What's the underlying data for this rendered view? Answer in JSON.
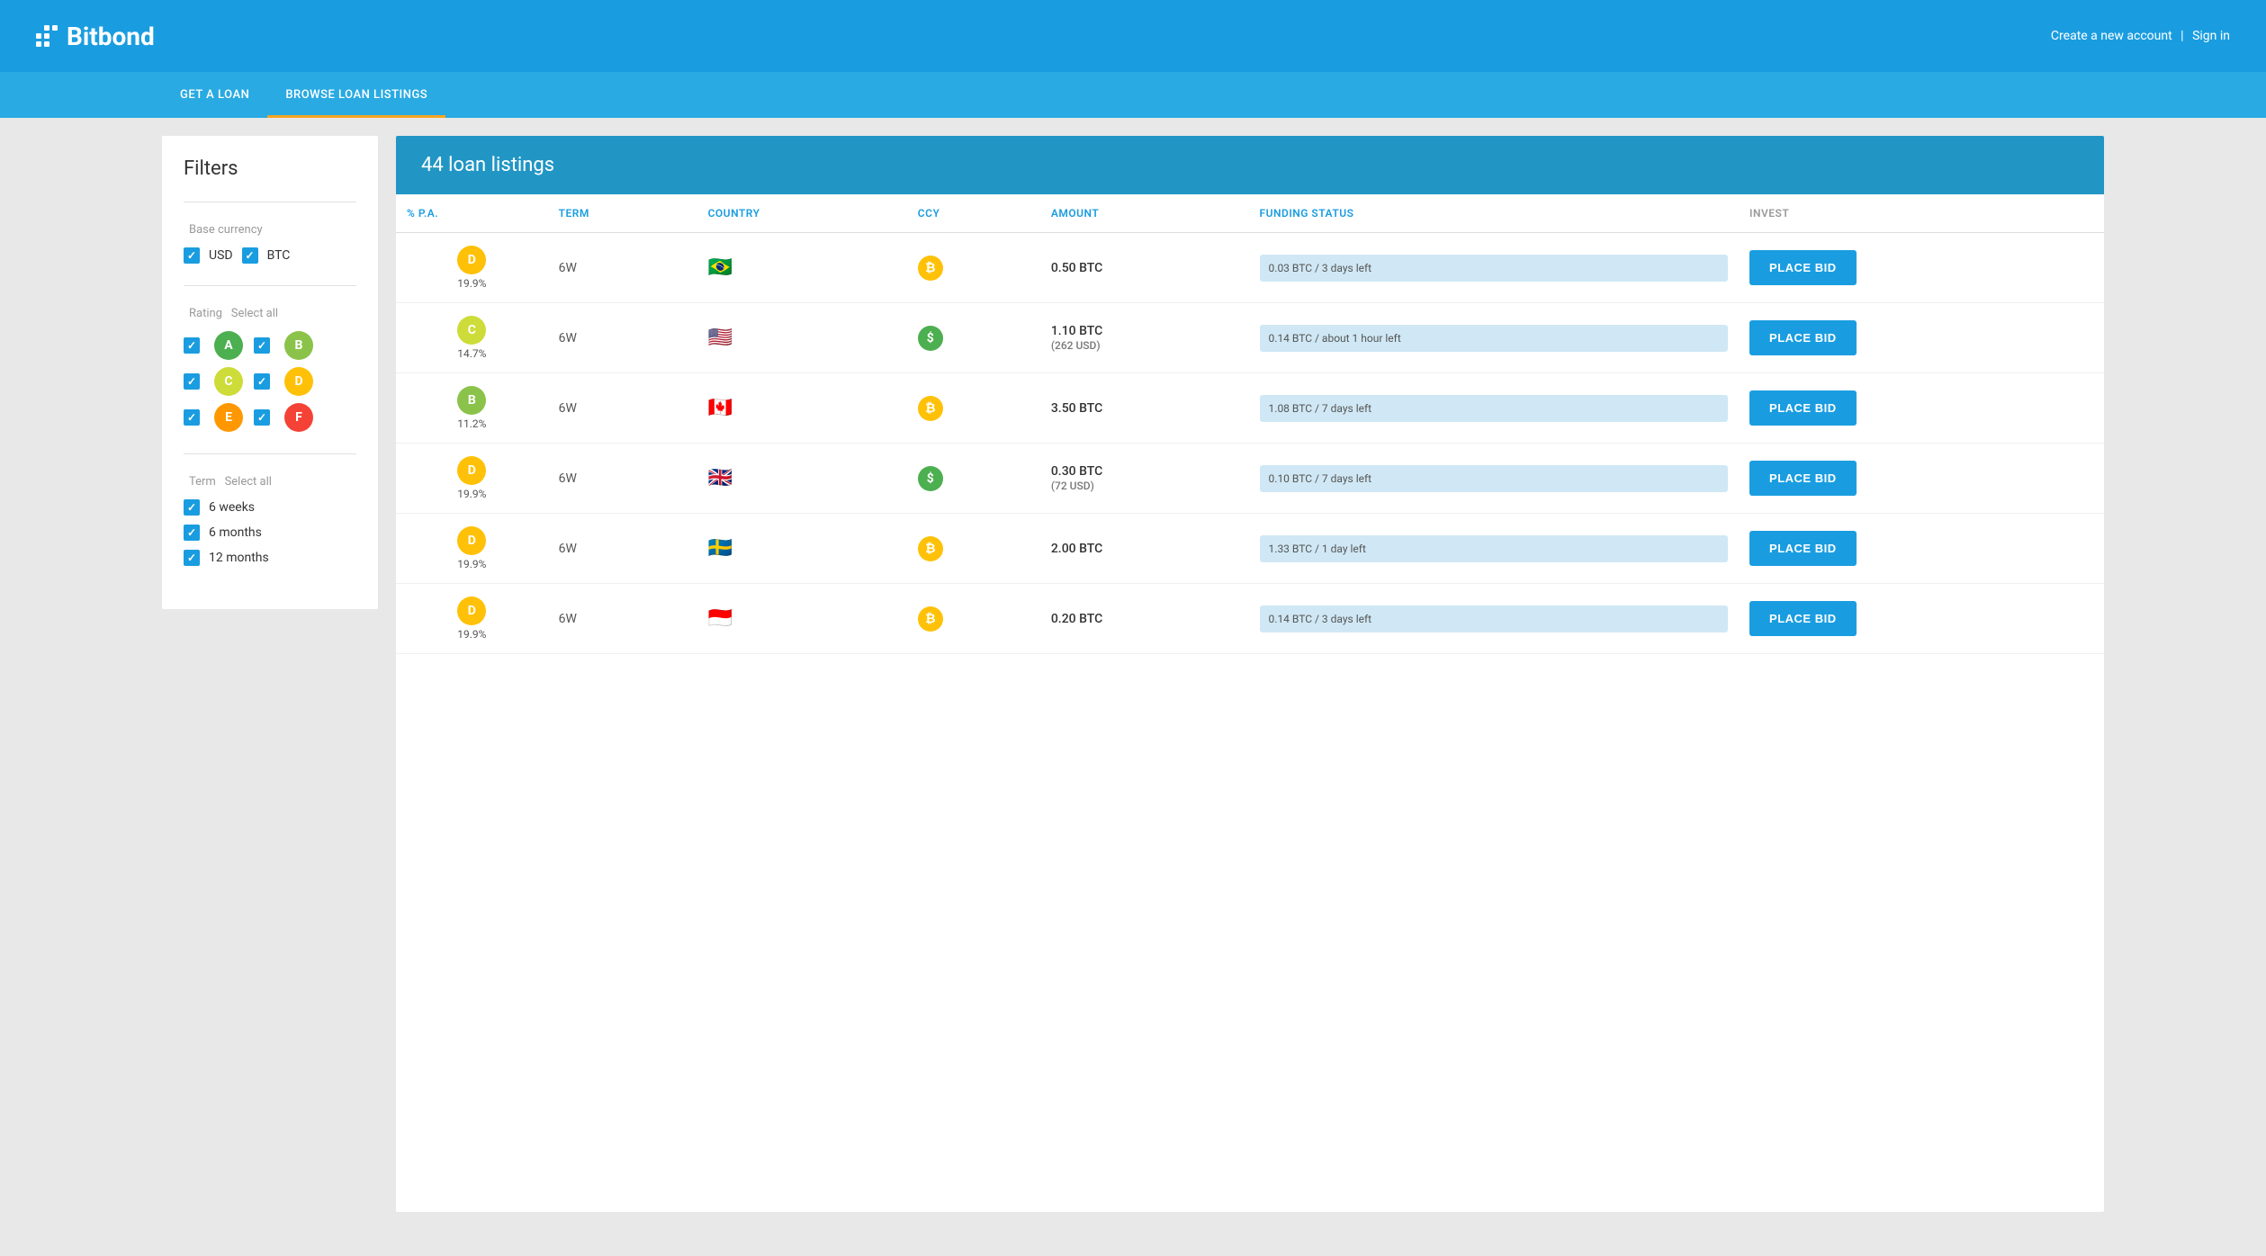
{
  "header": {
    "logo_text": "Bitbond",
    "create_account": "Create a new account",
    "separator": "|",
    "sign_in": "Sign in"
  },
  "nav": {
    "items": [
      {
        "id": "get-a-loan",
        "label": "GET A LOAN",
        "active": false
      },
      {
        "id": "browse-loan-listings",
        "label": "BROWSE LOAN LISTINGS",
        "active": true
      }
    ]
  },
  "filters": {
    "title": "Filters",
    "sections": [
      {
        "id": "base-currency",
        "title": "Base currency",
        "select_all": null,
        "currencies": [
          {
            "id": "usd",
            "label": "USD",
            "checked": true
          },
          {
            "id": "btc",
            "label": "BTC",
            "checked": true
          }
        ]
      },
      {
        "id": "rating",
        "title": "Rating",
        "select_all": "Select all",
        "badges": [
          {
            "id": "a",
            "label": "A",
            "color": "#4caf50",
            "checked": true
          },
          {
            "id": "b",
            "label": "B",
            "color": "#8bc34a",
            "checked": true
          },
          {
            "id": "c",
            "label": "C",
            "color": "#cddc39",
            "checked": true
          },
          {
            "id": "d",
            "label": "D",
            "color": "#ffc107",
            "checked": true
          },
          {
            "id": "e",
            "label": "E",
            "color": "#ff9800",
            "checked": true
          },
          {
            "id": "f",
            "label": "F",
            "color": "#f44336",
            "checked": true
          }
        ]
      },
      {
        "id": "term",
        "title": "Term",
        "select_all": "Select all",
        "terms": [
          {
            "id": "6w",
            "label": "6 weeks",
            "checked": true
          },
          {
            "id": "6m",
            "label": "6 months",
            "checked": true
          },
          {
            "id": "12m",
            "label": "12 months",
            "checked": true
          }
        ]
      }
    ]
  },
  "listings": {
    "title": "44 loan listings",
    "columns": [
      {
        "id": "pct",
        "label": "% P.A.",
        "color": "blue"
      },
      {
        "id": "term",
        "label": "TERM",
        "color": "blue"
      },
      {
        "id": "country",
        "label": "COUNTRY",
        "color": "blue"
      },
      {
        "id": "ccy",
        "label": "CCY",
        "color": "blue"
      },
      {
        "id": "amount",
        "label": "AMOUNT",
        "color": "blue"
      },
      {
        "id": "funding_status",
        "label": "FUNDING STATUS",
        "color": "blue"
      },
      {
        "id": "invest",
        "label": "INVEST",
        "color": "gray"
      }
    ],
    "rows": [
      {
        "rating": "D",
        "rating_color": "#ffc107",
        "pct": "19.9%",
        "term": "6W",
        "country_flag": "🇧🇷",
        "ccy_symbol": "₿",
        "ccy_color": "#ffc107",
        "amount": "0.50 BTC",
        "amount_sub": null,
        "funding": "0.03 BTC / 3 days left",
        "btn_label": "PLACE BID"
      },
      {
        "rating": "C",
        "rating_color": "#cddc39",
        "pct": "14.7%",
        "term": "6W",
        "country_flag": "🇺🇸",
        "ccy_symbol": "$",
        "ccy_color": "#4caf50",
        "amount": "1.10 BTC",
        "amount_sub": "(262 USD)",
        "funding": "0.14 BTC / about 1 hour left",
        "btn_label": "PLACE BID"
      },
      {
        "rating": "B",
        "rating_color": "#8bc34a",
        "pct": "11.2%",
        "term": "6W",
        "country_flag": "🇨🇦",
        "ccy_symbol": "₿",
        "ccy_color": "#ffc107",
        "amount": "3.50 BTC",
        "amount_sub": null,
        "funding": "1.08 BTC / 7 days left",
        "btn_label": "PLACE BID"
      },
      {
        "rating": "D",
        "rating_color": "#ffc107",
        "pct": "19.9%",
        "term": "6W",
        "country_flag": "🇬🇧",
        "ccy_symbol": "$",
        "ccy_color": "#4caf50",
        "amount": "0.30 BTC",
        "amount_sub": "(72 USD)",
        "funding": "0.10 BTC / 7 days left",
        "btn_label": "PLACE BID"
      },
      {
        "rating": "D",
        "rating_color": "#ffc107",
        "pct": "19.9%",
        "term": "6W",
        "country_flag": "🇸🇪",
        "ccy_symbol": "₿",
        "ccy_color": "#ffc107",
        "amount": "2.00 BTC",
        "amount_sub": null,
        "funding": "1.33 BTC / 1 day left",
        "btn_label": "PLACE BID"
      },
      {
        "rating": "D",
        "rating_color": "#ffc107",
        "pct": "19.9%",
        "term": "6W",
        "country_flag": "🇮🇩",
        "ccy_symbol": "₿",
        "ccy_color": "#ffc107",
        "amount": "0.20 BTC",
        "amount_sub": null,
        "funding": "0.14 BTC / 3 days left",
        "btn_label": "PLACE BID"
      }
    ]
  }
}
